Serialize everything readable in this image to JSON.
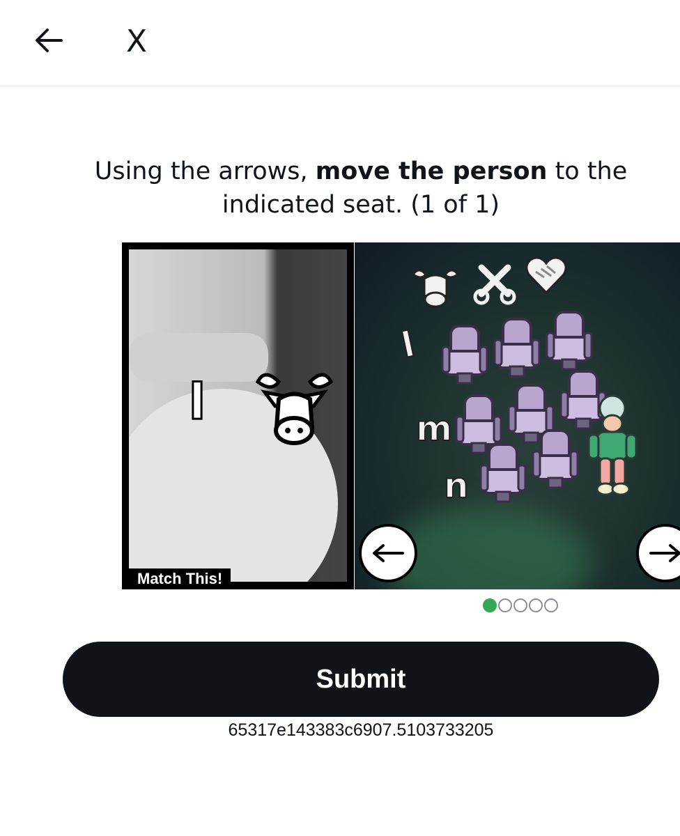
{
  "header": {
    "back_icon": "arrow-left-icon",
    "close_label": "X"
  },
  "instruction": {
    "part1": "Using the arrows, ",
    "bold": "move the person",
    "part2": " to the indicated seat. (1 of 1)"
  },
  "puzzle": {
    "match_label": "Match This!",
    "reference_letter": "l",
    "reference_icon": "cow-head-icon",
    "scene_icons": [
      "cow-head-icon",
      "scissors-icon",
      "handshake-heart-icon"
    ],
    "row_letters": [
      "l",
      "m",
      "n"
    ],
    "prev_icon": "arrow-left-icon",
    "next_icon": "arrow-right-icon"
  },
  "pagination": {
    "total": 5,
    "active_index": 0,
    "active_color": "#34a853"
  },
  "submit_label": "Submit",
  "session_id": "65317e143383c6907.5103733205"
}
